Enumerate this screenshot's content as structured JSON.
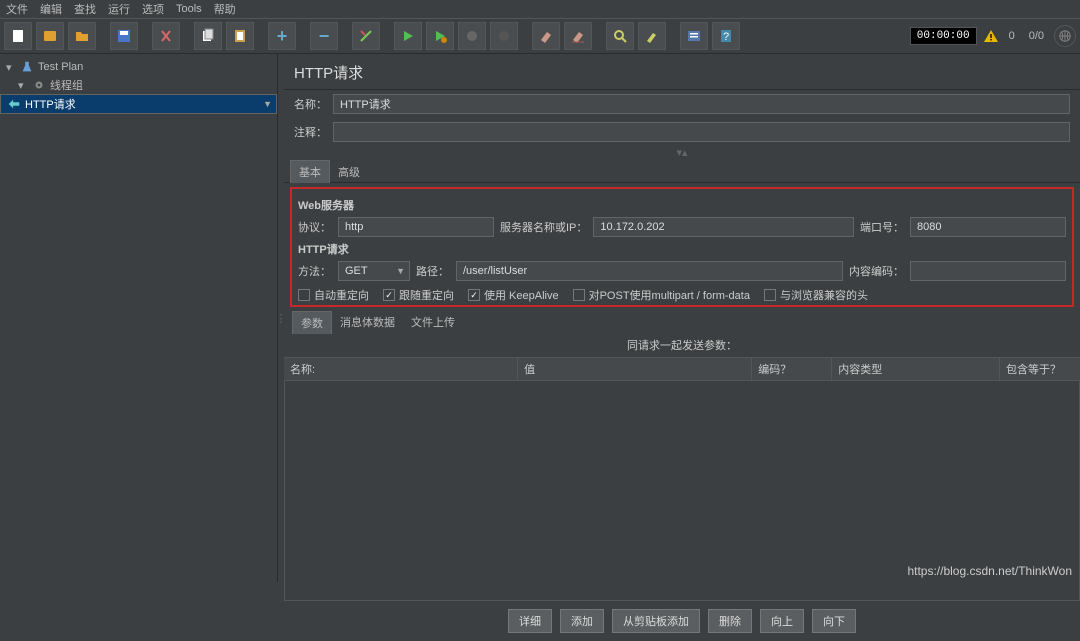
{
  "menu": [
    "文件",
    "编辑",
    "查找",
    "运行",
    "选项",
    "Tools",
    "帮助"
  ],
  "tree": {
    "root": "Test Plan",
    "group": "线程组",
    "item": "HTTP请求"
  },
  "panel": {
    "title": "HTTP请求",
    "name_lbl": "名称：",
    "name_val": "HTTP请求",
    "comment_lbl": "注释："
  },
  "tabs": {
    "basic": "基本",
    "advanced": "高级"
  },
  "webserver": {
    "heading": "Web服务器",
    "proto_lbl": "协议：",
    "proto_val": "http",
    "host_lbl": "服务器名称或IP：",
    "host_val": "10.172.0.202",
    "port_lbl": "端口号：",
    "port_val": "8080"
  },
  "httpreq": {
    "heading": "HTTP请求",
    "method_lbl": "方法：",
    "method_val": "GET",
    "path_lbl": "路径：",
    "path_val": "/user/listUser",
    "enc_lbl": "内容编码："
  },
  "checks": {
    "c1": "自动重定向",
    "c2": "跟随重定向",
    "c3": "使用 KeepAlive",
    "c4": "对POST使用multipart / form-data",
    "c5": "与浏览器兼容的头"
  },
  "subtabs": {
    "params": "参数",
    "body": "消息体数据",
    "upload": "文件上传"
  },
  "params_header": "同请求一起发送参数：",
  "cols": {
    "name": "名称:",
    "value": "值",
    "encode": "编码？",
    "ctype": "内容类型",
    "include": "包含等于？"
  },
  "buttons": {
    "detail": "详细",
    "add": "添加",
    "clip": "从剪贴板添加",
    "del": "删除",
    "up": "向上",
    "down": "向下"
  },
  "status": {
    "timer": "00:00:00",
    "warn": "0",
    "thread": "0/0"
  },
  "watermark": "https://blog.csdn.net/ThinkWon"
}
